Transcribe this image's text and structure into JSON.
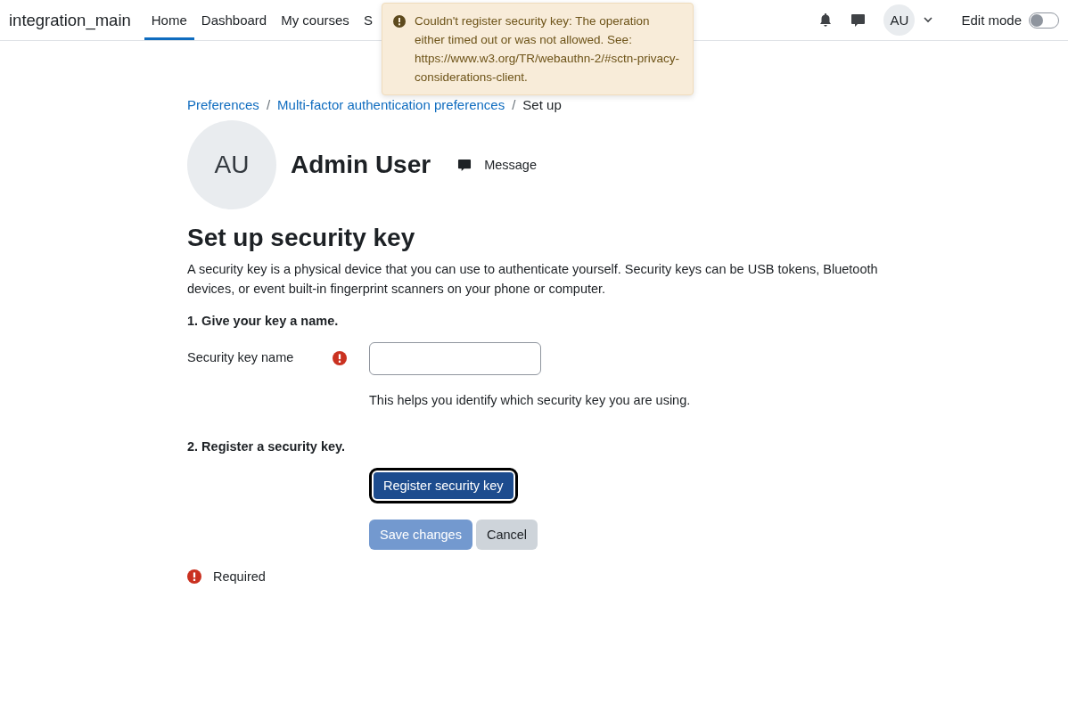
{
  "navbar": {
    "brand": "integration_main",
    "items": [
      {
        "label": "Home",
        "selected": true
      },
      {
        "label": "Dashboard",
        "selected": false
      },
      {
        "label": "My courses",
        "selected": false
      },
      {
        "label": "S",
        "selected": false
      }
    ],
    "avatar": "AU",
    "edit_mode": {
      "label": "Edit mode",
      "on": false
    }
  },
  "toast": {
    "text": "Couldn't register security key: The operation either timed out or was not allowed. See: https://www.w3.org/TR/webauthn-2/#sctn-privacy-considerations-client."
  },
  "breadcrumb_separator": "/",
  "breadcrumb": [
    {
      "label": "Preferences",
      "link": true
    },
    {
      "label": "Multi-factor authentication preferences",
      "link": true
    },
    {
      "label": "Set up",
      "link": false
    }
  ],
  "user": {
    "avatar": "AU",
    "name": "Admin User",
    "message": "Message"
  },
  "heading": "Set up security key",
  "intro": "A security key is a physical device that you can use to authenticate yourself. Security keys can be USB tokens, Bluetooth devices, or event built-in fingerprint scanners on your phone or computer.",
  "step1": "1. Give your key a name.",
  "field": {
    "label": "Security key name",
    "required": true,
    "help": "This helps you identify which security key you are using."
  },
  "step2": "2. Register a security key.",
  "register_button": "Register security key",
  "buttons": [
    {
      "label": "Save changes",
      "kind": "primary",
      "disabled": true
    },
    {
      "label": "Cancel",
      "kind": "secondary",
      "disabled": false
    }
  ],
  "required_note": "Required"
}
